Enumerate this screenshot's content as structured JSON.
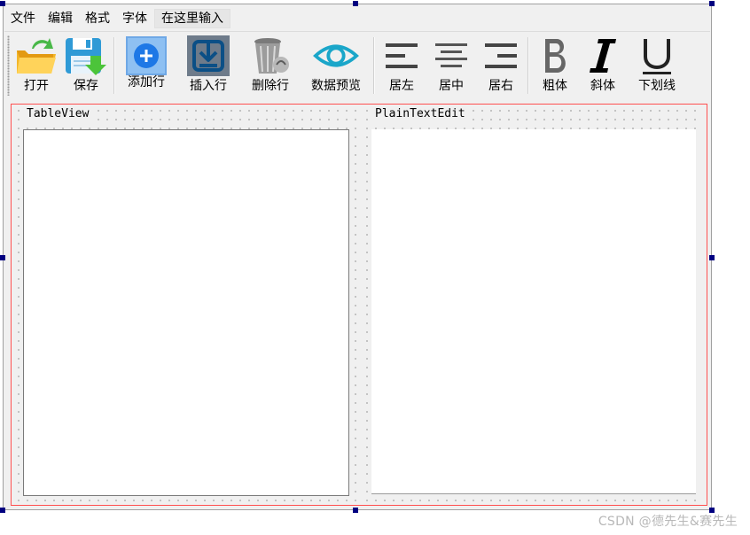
{
  "menubar": {
    "items": [
      "文件",
      "编辑",
      "格式",
      "字体"
    ],
    "placeholder": "在这里输入"
  },
  "toolbar": {
    "buttons": [
      {
        "id": "open",
        "label": "打开",
        "icon": "open-folder-icon"
      },
      {
        "id": "save",
        "label": "保存",
        "icon": "save-disk-icon"
      },
      {
        "id": "add_row",
        "label": "添加行",
        "icon": "add-circle-icon"
      },
      {
        "id": "insert_row",
        "label": "插入行",
        "icon": "insert-download-icon"
      },
      {
        "id": "delete_row",
        "label": "删除行",
        "icon": "trash-can-icon"
      },
      {
        "id": "data_preview",
        "label": "数据预览",
        "icon": "eye-icon"
      },
      {
        "id": "align_left",
        "label": "居左",
        "icon": "align-left-icon"
      },
      {
        "id": "align_center",
        "label": "居中",
        "icon": "align-center-icon"
      },
      {
        "id": "align_right",
        "label": "居右",
        "icon": "align-right-icon"
      },
      {
        "id": "bold",
        "label": "粗体",
        "icon": "bold-icon"
      },
      {
        "id": "italic",
        "label": "斜体",
        "icon": "italic-icon"
      },
      {
        "id": "underline",
        "label": "下划线",
        "icon": "underline-icon"
      }
    ]
  },
  "central": {
    "left_group_title": "TableView",
    "right_group_title": "PlainTextEdit"
  },
  "watermark": "CSDN @德先生&赛先生",
  "colors": {
    "selection_handle": "#000080",
    "layout_border": "#ff5050",
    "eye_icon": "#1aa6c9",
    "add_icon": "#1e90ff",
    "insert_icon": "#0b4f86",
    "format_icon": "#444444"
  }
}
